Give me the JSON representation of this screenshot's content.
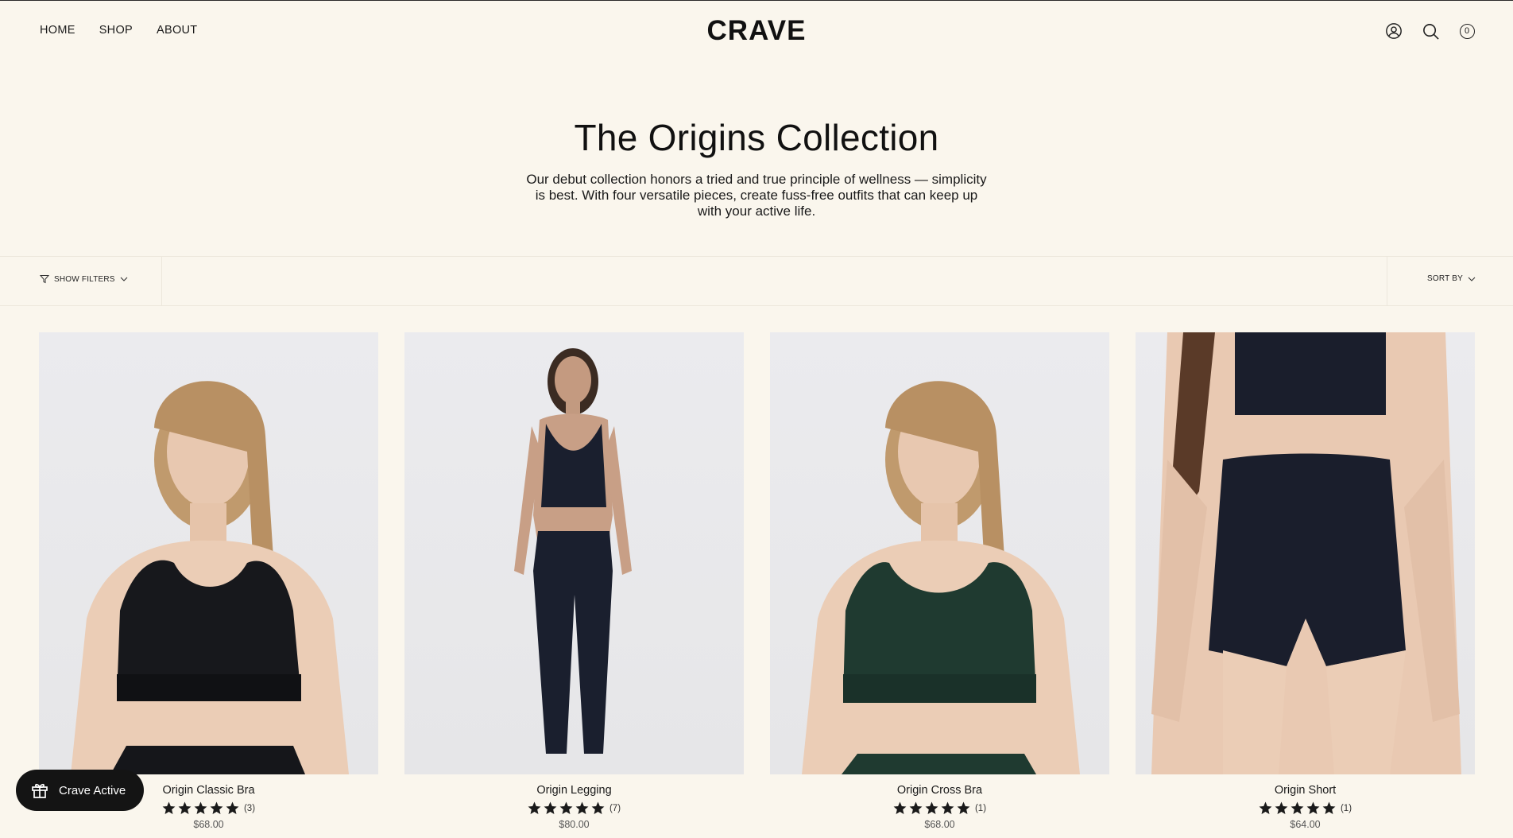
{
  "header": {
    "nav": [
      "HOME",
      "SHOP",
      "ABOUT"
    ],
    "logo": "CRAVE",
    "cart_count": "0"
  },
  "hero": {
    "title": "The Origins Collection",
    "description": "Our debut collection honors a tried and true principle of wellness — simplicity is best. With four versatile pieces, create fuss-free outfits that can keep up with your active life."
  },
  "filters": {
    "show_filters_label": "SHOW FILTERS",
    "sort_label": "SORT BY"
  },
  "products": [
    {
      "name": "Origin Classic Bra",
      "rating": 5,
      "review_count": "(3)",
      "price": "$68.00",
      "garment_color": "#16171b"
    },
    {
      "name": "Origin Legging",
      "rating": 5,
      "review_count": "(7)",
      "price": "$80.00",
      "garment_color": "#1a1f2e"
    },
    {
      "name": "Origin Cross Bra",
      "rating": 5,
      "review_count": "(1)",
      "price": "$68.00",
      "garment_color": "#1f3a30"
    },
    {
      "name": "Origin Short",
      "rating": 5,
      "review_count": "(1)",
      "price": "$64.00",
      "garment_color": "#1a1e2c"
    }
  ],
  "rewards": {
    "label": "Crave Active"
  },
  "colors": {
    "background": "#faf6ed",
    "text": "#1a1a1a",
    "pill": "#141414"
  }
}
